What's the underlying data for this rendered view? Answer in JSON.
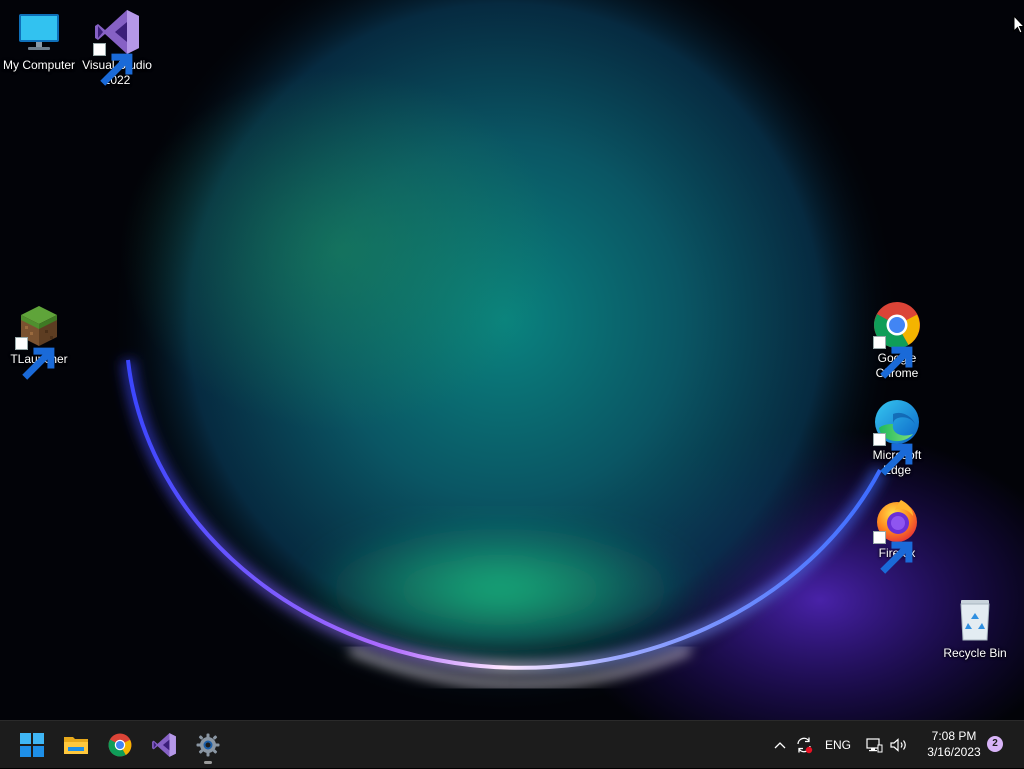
{
  "desktop": {
    "icons": [
      {
        "label": "My Computer",
        "icon": "monitor-icon",
        "shortcut": false
      },
      {
        "label": "Visual Studio 2022",
        "icon": "visual-studio-icon",
        "shortcut": true
      },
      {
        "label": "TLauncher",
        "icon": "minecraft-grass-block-icon",
        "shortcut": true
      },
      {
        "label": "Google Chrome",
        "icon": "chrome-icon",
        "shortcut": true
      },
      {
        "label": "Microsoft Edge",
        "icon": "edge-icon",
        "shortcut": true
      },
      {
        "label": "Firefox",
        "icon": "firefox-icon",
        "shortcut": true
      },
      {
        "label": "Recycle Bin",
        "icon": "recycle-bin-icon",
        "shortcut": false
      }
    ]
  },
  "taskbar": {
    "apps": [
      {
        "name": "Start",
        "icon": "windows-start-icon"
      },
      {
        "name": "File Explorer",
        "icon": "folder-icon"
      },
      {
        "name": "Google Chrome",
        "icon": "chrome-icon"
      },
      {
        "name": "Visual Studio",
        "icon": "visual-studio-icon"
      },
      {
        "name": "Settings",
        "icon": "settings-gear-icon",
        "running": true
      }
    ],
    "tray": {
      "language": "ENG",
      "time": "7:08 PM",
      "date": "3/16/2023",
      "notification_count": "2"
    }
  },
  "colors": {
    "taskbar_bg": "#1c1c1c",
    "wallpaper_bloom_green": "#1fc88a",
    "wallpaper_rim_violet": "#8a5cff",
    "notification_badge": "#d8b4f8"
  }
}
